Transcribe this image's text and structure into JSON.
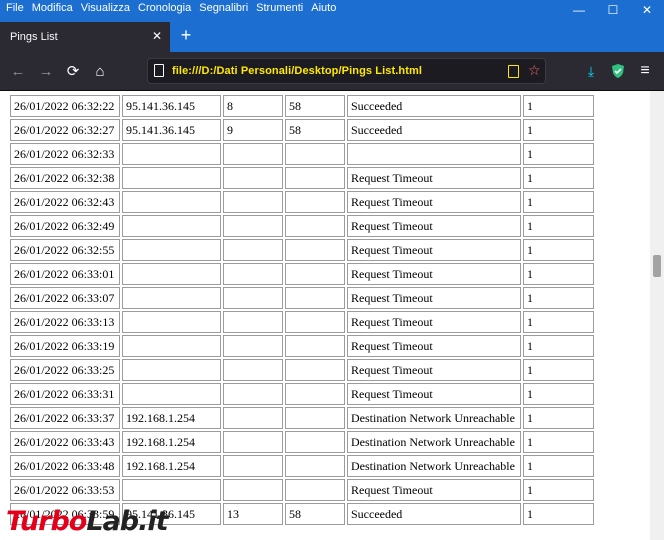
{
  "menu": {
    "items": [
      "File",
      "Modifica",
      "Visualizza",
      "Cronologia",
      "Segnalibri",
      "Strumenti",
      "Aiuto"
    ],
    "access_keys": [
      "F",
      "M",
      "V",
      "C",
      "S",
      "S",
      "A"
    ]
  },
  "window": {
    "minimize_glyph": "—",
    "maximize_glyph": "☐",
    "close_glyph": "✕"
  },
  "tab": {
    "title": "Pings List",
    "close_glyph": "✕",
    "new_tab_glyph": "+"
  },
  "toolbar": {
    "back_glyph": "←",
    "forward_glyph": "→",
    "reload_glyph": "⟳",
    "home_glyph": "⌂",
    "url": "file:///D:/Dati Personali/Desktop/Pings List.html",
    "bookmark_glyph": "☆",
    "download_glyph": "⤓",
    "shield_glyph": "⛉",
    "menu_glyph": "≡"
  },
  "rows": [
    {
      "time": "26/01/2022 06:32:22",
      "ip": "95.141.36.145",
      "n": "8",
      "ttl": "58",
      "status": "Succeeded",
      "count": "1"
    },
    {
      "time": "26/01/2022 06:32:27",
      "ip": "95.141.36.145",
      "n": "9",
      "ttl": "58",
      "status": "Succeeded",
      "count": "1"
    },
    {
      "time": "26/01/2022 06:32:33",
      "ip": "",
      "n": "",
      "ttl": "",
      "status": "",
      "count": "1"
    },
    {
      "time": "26/01/2022 06:32:38",
      "ip": "",
      "n": "",
      "ttl": "",
      "status": "Request Timeout",
      "count": "1"
    },
    {
      "time": "26/01/2022 06:32:43",
      "ip": "",
      "n": "",
      "ttl": "",
      "status": "Request Timeout",
      "count": "1"
    },
    {
      "time": "26/01/2022 06:32:49",
      "ip": "",
      "n": "",
      "ttl": "",
      "status": "Request Timeout",
      "count": "1"
    },
    {
      "time": "26/01/2022 06:32:55",
      "ip": "",
      "n": "",
      "ttl": "",
      "status": "Request Timeout",
      "count": "1"
    },
    {
      "time": "26/01/2022 06:33:01",
      "ip": "",
      "n": "",
      "ttl": "",
      "status": "Request Timeout",
      "count": "1"
    },
    {
      "time": "26/01/2022 06:33:07",
      "ip": "",
      "n": "",
      "ttl": "",
      "status": "Request Timeout",
      "count": "1"
    },
    {
      "time": "26/01/2022 06:33:13",
      "ip": "",
      "n": "",
      "ttl": "",
      "status": "Request Timeout",
      "count": "1"
    },
    {
      "time": "26/01/2022 06:33:19",
      "ip": "",
      "n": "",
      "ttl": "",
      "status": "Request Timeout",
      "count": "1"
    },
    {
      "time": "26/01/2022 06:33:25",
      "ip": "",
      "n": "",
      "ttl": "",
      "status": "Request Timeout",
      "count": "1"
    },
    {
      "time": "26/01/2022 06:33:31",
      "ip": "",
      "n": "",
      "ttl": "",
      "status": "Request Timeout",
      "count": "1"
    },
    {
      "time": "26/01/2022 06:33:37",
      "ip": "192.168.1.254",
      "n": "",
      "ttl": "",
      "status": "Destination Network Unreachable",
      "count": "1"
    },
    {
      "time": "26/01/2022 06:33:43",
      "ip": "192.168.1.254",
      "n": "",
      "ttl": "",
      "status": "Destination Network Unreachable",
      "count": "1"
    },
    {
      "time": "26/01/2022 06:33:48",
      "ip": "192.168.1.254",
      "n": "",
      "ttl": "",
      "status": "Destination Network Unreachable",
      "count": "1"
    },
    {
      "time": "26/01/2022 06:33:53",
      "ip": "",
      "n": "",
      "ttl": "",
      "status": "Request Timeout",
      "count": "1"
    },
    {
      "time": "26/01/2022 06:33:59",
      "ip": "95.141.36.145",
      "n": "13",
      "ttl": "58",
      "status": "Succeeded",
      "count": "1"
    }
  ],
  "watermark": {
    "part1": "Turbo",
    "part2": "Lab.it"
  },
  "colors": {
    "titlebar": "#1c6fd1",
    "toolbar": "#2b2a33",
    "url_text": "#ffe900",
    "watermark_red": "#e3001b"
  }
}
